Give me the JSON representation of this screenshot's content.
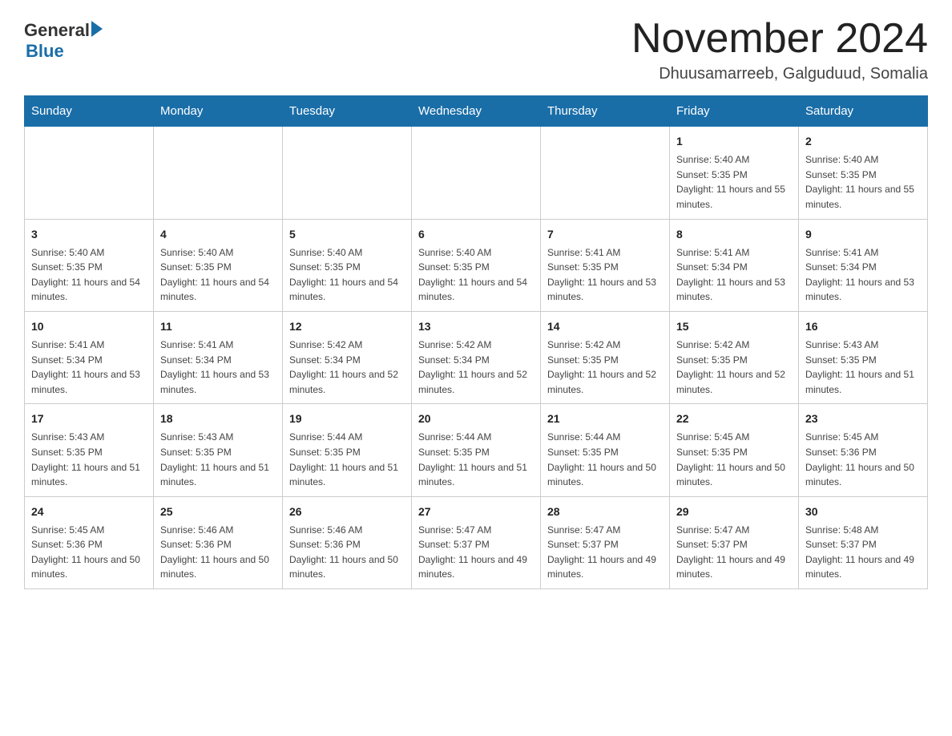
{
  "logo": {
    "general": "General",
    "blue": "Blue"
  },
  "header": {
    "title": "November 2024",
    "subtitle": "Dhuusamarreeb, Galguduud, Somalia"
  },
  "weekdays": [
    "Sunday",
    "Monday",
    "Tuesday",
    "Wednesday",
    "Thursday",
    "Friday",
    "Saturday"
  ],
  "weeks": [
    [
      {
        "day": "",
        "info": ""
      },
      {
        "day": "",
        "info": ""
      },
      {
        "day": "",
        "info": ""
      },
      {
        "day": "",
        "info": ""
      },
      {
        "day": "",
        "info": ""
      },
      {
        "day": "1",
        "info": "Sunrise: 5:40 AM\nSunset: 5:35 PM\nDaylight: 11 hours and 55 minutes."
      },
      {
        "day": "2",
        "info": "Sunrise: 5:40 AM\nSunset: 5:35 PM\nDaylight: 11 hours and 55 minutes."
      }
    ],
    [
      {
        "day": "3",
        "info": "Sunrise: 5:40 AM\nSunset: 5:35 PM\nDaylight: 11 hours and 54 minutes."
      },
      {
        "day": "4",
        "info": "Sunrise: 5:40 AM\nSunset: 5:35 PM\nDaylight: 11 hours and 54 minutes."
      },
      {
        "day": "5",
        "info": "Sunrise: 5:40 AM\nSunset: 5:35 PM\nDaylight: 11 hours and 54 minutes."
      },
      {
        "day": "6",
        "info": "Sunrise: 5:40 AM\nSunset: 5:35 PM\nDaylight: 11 hours and 54 minutes."
      },
      {
        "day": "7",
        "info": "Sunrise: 5:41 AM\nSunset: 5:35 PM\nDaylight: 11 hours and 53 minutes."
      },
      {
        "day": "8",
        "info": "Sunrise: 5:41 AM\nSunset: 5:34 PM\nDaylight: 11 hours and 53 minutes."
      },
      {
        "day": "9",
        "info": "Sunrise: 5:41 AM\nSunset: 5:34 PM\nDaylight: 11 hours and 53 minutes."
      }
    ],
    [
      {
        "day": "10",
        "info": "Sunrise: 5:41 AM\nSunset: 5:34 PM\nDaylight: 11 hours and 53 minutes."
      },
      {
        "day": "11",
        "info": "Sunrise: 5:41 AM\nSunset: 5:34 PM\nDaylight: 11 hours and 53 minutes."
      },
      {
        "day": "12",
        "info": "Sunrise: 5:42 AM\nSunset: 5:34 PM\nDaylight: 11 hours and 52 minutes."
      },
      {
        "day": "13",
        "info": "Sunrise: 5:42 AM\nSunset: 5:34 PM\nDaylight: 11 hours and 52 minutes."
      },
      {
        "day": "14",
        "info": "Sunrise: 5:42 AM\nSunset: 5:35 PM\nDaylight: 11 hours and 52 minutes."
      },
      {
        "day": "15",
        "info": "Sunrise: 5:42 AM\nSunset: 5:35 PM\nDaylight: 11 hours and 52 minutes."
      },
      {
        "day": "16",
        "info": "Sunrise: 5:43 AM\nSunset: 5:35 PM\nDaylight: 11 hours and 51 minutes."
      }
    ],
    [
      {
        "day": "17",
        "info": "Sunrise: 5:43 AM\nSunset: 5:35 PM\nDaylight: 11 hours and 51 minutes."
      },
      {
        "day": "18",
        "info": "Sunrise: 5:43 AM\nSunset: 5:35 PM\nDaylight: 11 hours and 51 minutes."
      },
      {
        "day": "19",
        "info": "Sunrise: 5:44 AM\nSunset: 5:35 PM\nDaylight: 11 hours and 51 minutes."
      },
      {
        "day": "20",
        "info": "Sunrise: 5:44 AM\nSunset: 5:35 PM\nDaylight: 11 hours and 51 minutes."
      },
      {
        "day": "21",
        "info": "Sunrise: 5:44 AM\nSunset: 5:35 PM\nDaylight: 11 hours and 50 minutes."
      },
      {
        "day": "22",
        "info": "Sunrise: 5:45 AM\nSunset: 5:35 PM\nDaylight: 11 hours and 50 minutes."
      },
      {
        "day": "23",
        "info": "Sunrise: 5:45 AM\nSunset: 5:36 PM\nDaylight: 11 hours and 50 minutes."
      }
    ],
    [
      {
        "day": "24",
        "info": "Sunrise: 5:45 AM\nSunset: 5:36 PM\nDaylight: 11 hours and 50 minutes."
      },
      {
        "day": "25",
        "info": "Sunrise: 5:46 AM\nSunset: 5:36 PM\nDaylight: 11 hours and 50 minutes."
      },
      {
        "day": "26",
        "info": "Sunrise: 5:46 AM\nSunset: 5:36 PM\nDaylight: 11 hours and 50 minutes."
      },
      {
        "day": "27",
        "info": "Sunrise: 5:47 AM\nSunset: 5:37 PM\nDaylight: 11 hours and 49 minutes."
      },
      {
        "day": "28",
        "info": "Sunrise: 5:47 AM\nSunset: 5:37 PM\nDaylight: 11 hours and 49 minutes."
      },
      {
        "day": "29",
        "info": "Sunrise: 5:47 AM\nSunset: 5:37 PM\nDaylight: 11 hours and 49 minutes."
      },
      {
        "day": "30",
        "info": "Sunrise: 5:48 AM\nSunset: 5:37 PM\nDaylight: 11 hours and 49 minutes."
      }
    ]
  ]
}
